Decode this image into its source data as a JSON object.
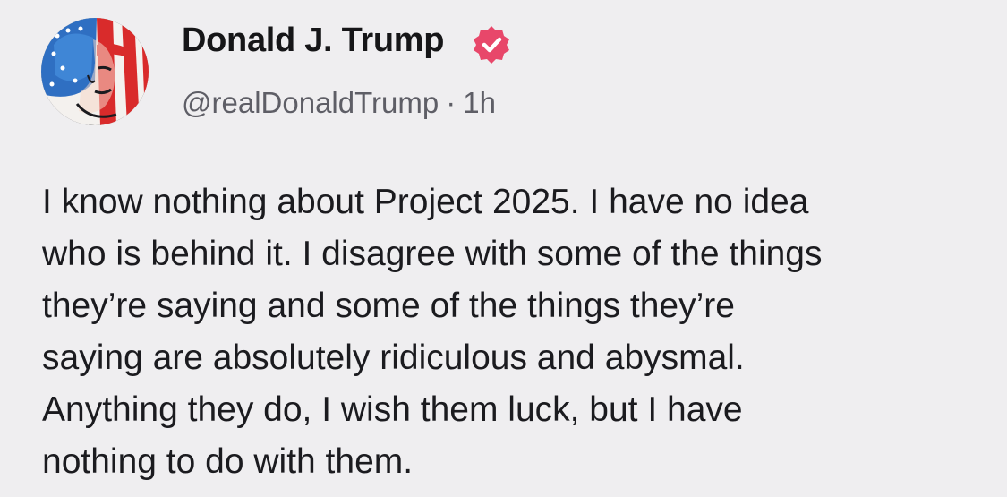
{
  "author": {
    "display_name": "Donald J. Trump",
    "handle": "@realDonaldTrump",
    "separator": "·",
    "timestamp": "1h",
    "verified": true,
    "verified_badge_color": "#e8476a",
    "avatar_icon": "american-flag-portrait"
  },
  "post": {
    "lines": [
      "I know nothing about Project 2025. I have no idea",
      "who is behind it. I disagree with some of the things",
      "they’re saying and some of the things they’re",
      "saying are absolutely ridiculous and abysmal.",
      "Anything they do, I wish them luck, but I have",
      "nothing to do with them."
    ]
  },
  "colors": {
    "background": "#efeef0",
    "text": "#1b1b1f",
    "muted": "#5e5e66"
  }
}
